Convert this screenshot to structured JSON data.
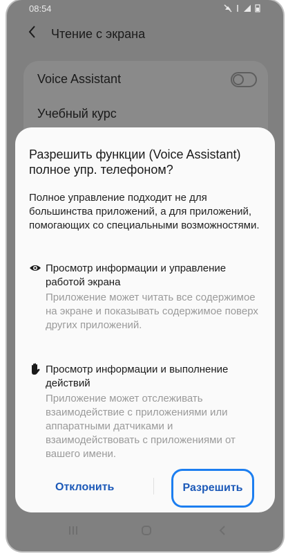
{
  "status": {
    "time": "08:54"
  },
  "header": {
    "title": "Чтение с экрана"
  },
  "settings": {
    "items": [
      {
        "label": "Voice Assistant"
      },
      {
        "label": "Учебный курс"
      }
    ]
  },
  "dialog": {
    "title": "Разрешить функции (Voice Assistant) полное упр. телефоном?",
    "body": "Полное управление подходит не для большинства приложений, а для приложений, помогающих со специальными возможностями.",
    "permissions": [
      {
        "icon": "eye-icon",
        "title": "Просмотр информации и управление работой экрана",
        "description": "Приложение может читать все содержимое на экране и показывать содержимое поверх других приложений."
      },
      {
        "icon": "hand-icon",
        "title": "Просмотр информации и выполнение действий",
        "description": "Приложение может отслеживать взаимодействие с приложениями или аппаратными датчиками и взаимодействовать с приложениями от вашего имени."
      }
    ],
    "buttons": {
      "deny": "Отклонить",
      "allow": "Разрешить"
    }
  },
  "colors": {
    "accent": "#1c59b8",
    "highlight": "#1c7ef0"
  }
}
